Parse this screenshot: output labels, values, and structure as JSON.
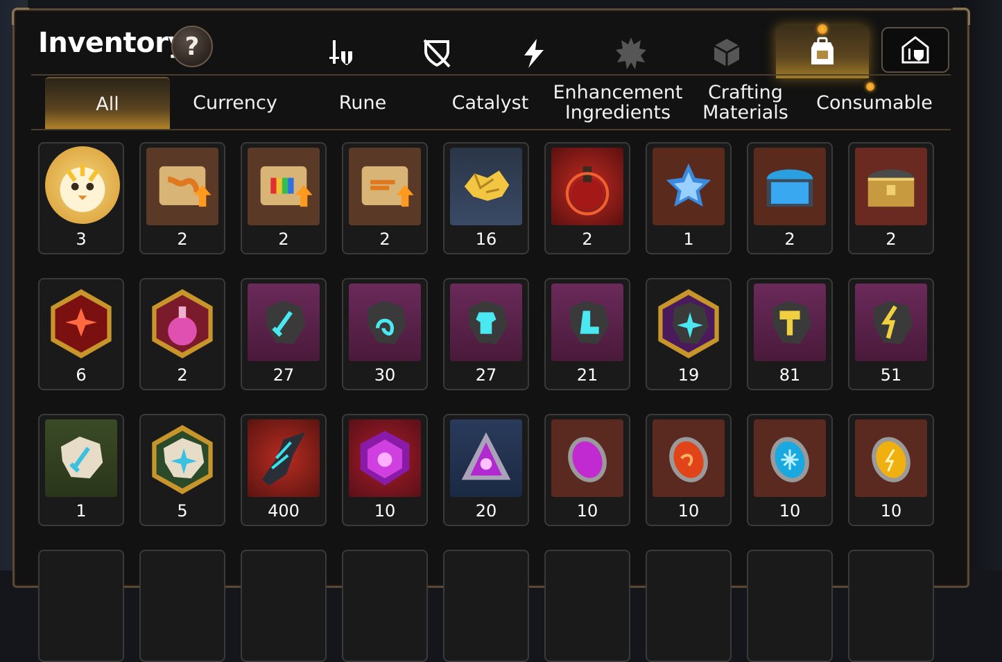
{
  "header": {
    "title": "Inventory",
    "help_label": "?"
  },
  "category_icons": [
    {
      "name": "equipment-icon"
    },
    {
      "name": "artifact-icon"
    },
    {
      "name": "lightning-icon"
    },
    {
      "name": "spiky-icon"
    },
    {
      "name": "dice-icon"
    },
    {
      "name": "bag-icon",
      "active": true
    },
    {
      "name": "storage-icon"
    }
  ],
  "tabs": [
    {
      "label": "All",
      "active": true
    },
    {
      "label": "Currency"
    },
    {
      "label": "Rune"
    },
    {
      "label": "Catalyst"
    },
    {
      "label": "Enhancement Ingredients"
    },
    {
      "label": "Crafting Materials"
    },
    {
      "label": "Consumable"
    }
  ],
  "items": [
    {
      "kind": "round",
      "art": "chick",
      "count": "3"
    },
    {
      "kind": "square",
      "art": "scroll-dragon",
      "count": "2"
    },
    {
      "kind": "square",
      "art": "scroll-rainbow",
      "count": "2"
    },
    {
      "kind": "square",
      "art": "scroll-plain",
      "count": "2"
    },
    {
      "kind": "square",
      "art": "gold-chunks",
      "count": "16"
    },
    {
      "kind": "square",
      "art": "red-potion",
      "count": "2"
    },
    {
      "kind": "square",
      "art": "star-potion",
      "count": "1"
    },
    {
      "kind": "square",
      "art": "blue-chest",
      "count": "2"
    },
    {
      "kind": "square",
      "art": "gold-chest",
      "count": "2"
    },
    {
      "kind": "hex",
      "art": "red-rune",
      "count": "6"
    },
    {
      "kind": "hex",
      "art": "pink-potion",
      "count": "2"
    },
    {
      "kind": "square",
      "art": "stone-sword",
      "count": "27"
    },
    {
      "kind": "square",
      "art": "stone-swirl",
      "count": "30"
    },
    {
      "kind": "square",
      "art": "stone-armor",
      "count": "27"
    },
    {
      "kind": "square",
      "art": "stone-boot",
      "count": "21"
    },
    {
      "kind": "hex",
      "art": "stone-star",
      "count": "19"
    },
    {
      "kind": "square",
      "art": "stone-hammer",
      "count": "81"
    },
    {
      "kind": "square",
      "art": "stone-bolt",
      "count": "51"
    },
    {
      "kind": "square",
      "art": "pale-sword",
      "count": "1"
    },
    {
      "kind": "hex",
      "art": "pale-star",
      "count": "5"
    },
    {
      "kind": "square",
      "art": "dark-crystal",
      "count": "400"
    },
    {
      "kind": "square",
      "art": "purple-hex",
      "count": "10"
    },
    {
      "kind": "square",
      "art": "purple-tri",
      "count": "20"
    },
    {
      "kind": "square",
      "art": "purple-orb",
      "count": "10"
    },
    {
      "kind": "square",
      "art": "fire-orb",
      "count": "10"
    },
    {
      "kind": "square",
      "art": "ice-orb",
      "count": "10"
    },
    {
      "kind": "square",
      "art": "gold-orb",
      "count": "10"
    }
  ],
  "colors": {
    "accent_gold": "#c8952b",
    "frame_brown": "#5a4a35",
    "notif_orange": "#ffb020"
  }
}
